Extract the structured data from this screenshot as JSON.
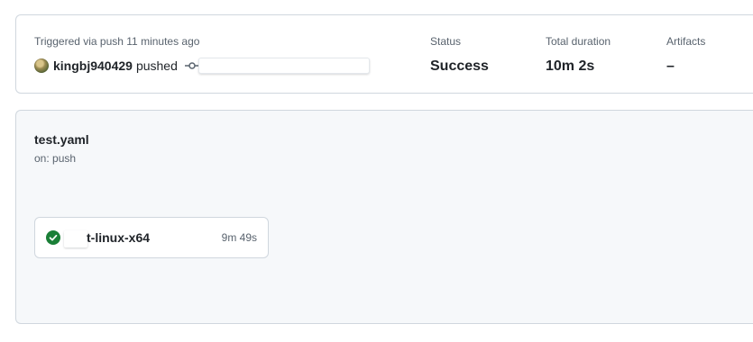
{
  "summary": {
    "trigger_text": "Triggered via push 11 minutes ago",
    "username": "kingbj940429",
    "action": "pushed",
    "stats": [
      {
        "label": "Status",
        "value": "Success"
      },
      {
        "label": "Total duration",
        "value": "10m 2s"
      },
      {
        "label": "Artifacts",
        "value": "–"
      }
    ]
  },
  "workflow": {
    "file_name": "test.yaml",
    "trigger": "on: push",
    "jobs": [
      {
        "name": "t-linux-x64",
        "duration": "9m 49s",
        "status": "success",
        "status_color": "#1a7f37"
      }
    ]
  },
  "icons": {
    "avatar": "user-avatar",
    "commit": "git-commit-icon",
    "job_status": "check-circle-fill-icon"
  }
}
